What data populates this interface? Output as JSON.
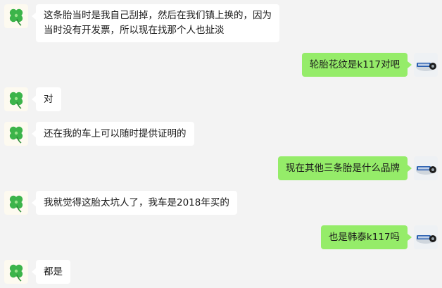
{
  "conversation": {
    "messages": [
      {
        "side": "left",
        "lines": [
          "这条胎当时是我自己刮掉，然后在我们镇上换的，因为",
          "当时没有开发票，所以现在找那个人也扯淡"
        ]
      },
      {
        "side": "right",
        "lines": [
          "轮胎花纹是k117对吧"
        ]
      },
      {
        "side": "left",
        "lines": [
          "对"
        ]
      },
      {
        "side": "left",
        "lines": [
          "还在我的车上可以随时提供证明的"
        ]
      },
      {
        "side": "right",
        "lines": [
          "现在其他三条胎是什么品牌"
        ]
      },
      {
        "side": "left",
        "lines": [
          "我就觉得这胎太坑人了，我车是2018年买的"
        ]
      },
      {
        "side": "right",
        "lines": [
          "也是韩泰k117吗"
        ]
      },
      {
        "side": "left",
        "lines": [
          "都是"
        ]
      }
    ]
  },
  "avatars": {
    "left_icon": "clover-icon",
    "right_icon": "car-badge-icon"
  },
  "colors": {
    "background": "#f3f3f3",
    "left_bubble": "#ffffff",
    "right_bubble": "#95ec69",
    "clover": "#3cb44a"
  }
}
